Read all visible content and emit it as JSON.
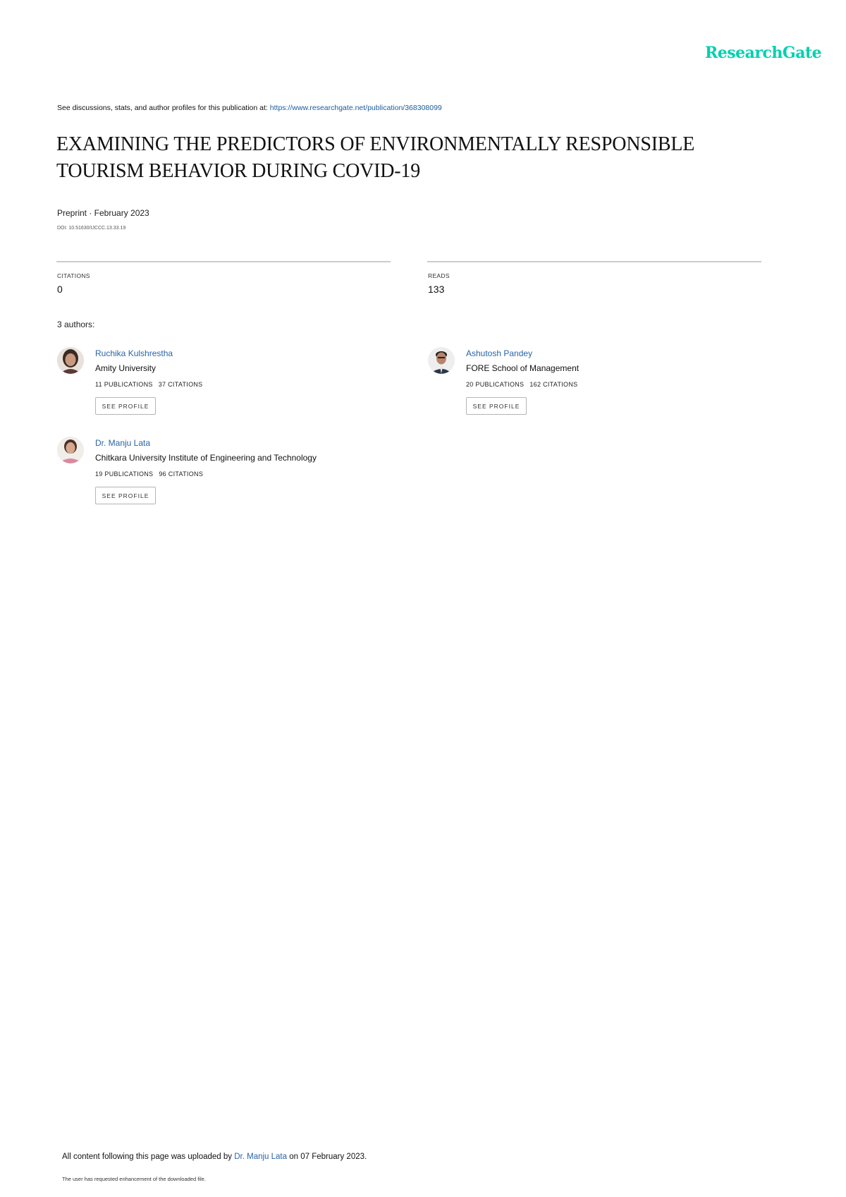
{
  "header": {
    "logo_text": "ResearchGate",
    "logo_color": "#00d0af",
    "discussion_prefix": "See discussions, stats, and author profiles for this publication at:",
    "publication_url": "https://www.researchgate.net/publication/368308099"
  },
  "publication": {
    "title_line1": "EXAMINING THE PREDICTORS OF ENVIRONMENTALLY RESPONSIBLE",
    "title_line2": "TOURISM BEHAVIOR DURING COVID-19",
    "type_date": "Preprint · February 2023",
    "doi": "DOI: 10.51630/IJCCC.13.33.19"
  },
  "stats": {
    "citations_label": "CITATIONS",
    "citations_value": "0",
    "reads_label": "READS",
    "reads_value": "133"
  },
  "authors_count_label": "3 authors:",
  "authors": [
    {
      "name": "Ruchika Kulshrestha",
      "institution": "Amity University",
      "publications": "11 PUBLICATIONS",
      "citations": "37 CITATIONS",
      "button": "SEE PROFILE"
    },
    {
      "name": "Ashutosh Pandey",
      "institution": "FORE School of Management",
      "publications": "20 PUBLICATIONS",
      "citations": "162 CITATIONS",
      "button": "SEE PROFILE"
    },
    {
      "name": "Dr. Manju Lata",
      "institution": "Chitkara University Institute of Engineering and Technology",
      "publications": "19 PUBLICATIONS",
      "citations": "96 CITATIONS",
      "button": "SEE PROFILE"
    }
  ],
  "footer": {
    "upload_prefix": "All content following this page was uploaded by",
    "uploader": "Dr. Manju Lata",
    "upload_suffix": "on 07 February 2023.",
    "note": "The user has requested enhancement of the downloaded file."
  }
}
